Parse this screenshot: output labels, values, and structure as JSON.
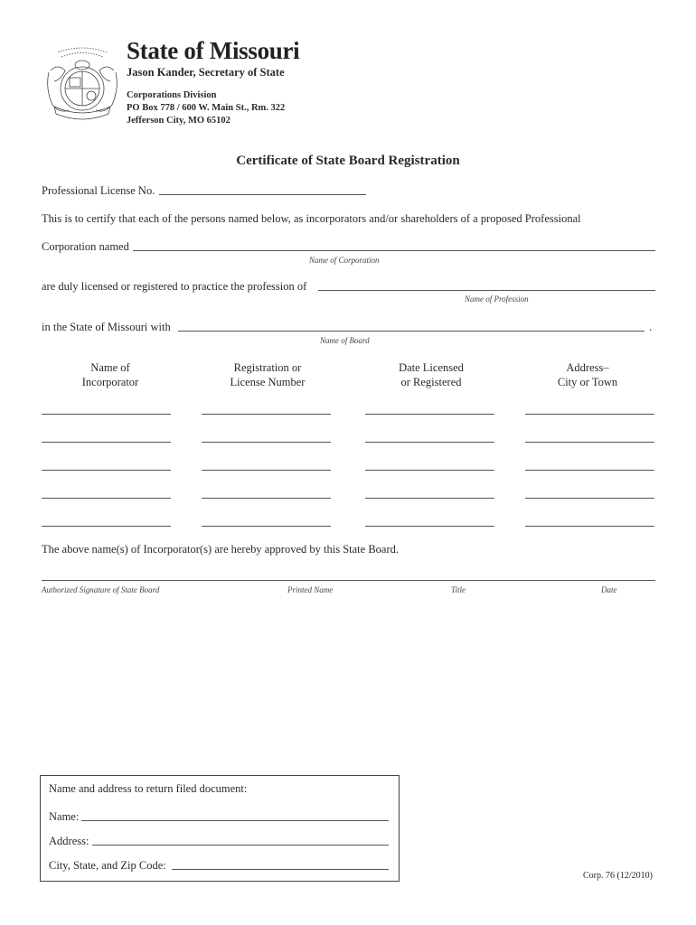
{
  "header": {
    "seal_icon": "missouri-state-seal",
    "state_title": "State of Missouri",
    "secretary": "Jason Kander, Secretary of State",
    "division": "Corporations Division",
    "address_line1": "PO Box 778 / 600 W. Main St., Rm. 322",
    "address_line2": "Jefferson City, MO 65102"
  },
  "document_title": "Certificate of State Board Registration",
  "fields": {
    "license_no_label": "Professional License No.",
    "license_no_value": "",
    "certify_text": "This is to certify that each of the persons named below, as incorporators and/or shareholders of a proposed Professional",
    "corporation_label": "Corporation named",
    "corporation_value": "",
    "corporation_caption": "Name of Corporation",
    "profession_label": "are duly licensed or registered to practice the profession of",
    "profession_value": "",
    "profession_caption": "Name of Profession",
    "board_label": "in the State of Missouri with",
    "board_value": "",
    "board_caption": "Name of Board",
    "board_period": "."
  },
  "incorporators_table": {
    "columns": [
      {
        "line1": "Name of",
        "line2": "Incorporator"
      },
      {
        "line1": "Registration or",
        "line2": "License Number"
      },
      {
        "line1": "Date Licensed",
        "line2": "or Registered"
      },
      {
        "line1": "Address–",
        "line2": "City or Town"
      }
    ],
    "rows": [
      [
        "",
        "",
        "",
        ""
      ],
      [
        "",
        "",
        "",
        ""
      ],
      [
        "",
        "",
        "",
        ""
      ],
      [
        "",
        "",
        "",
        ""
      ],
      [
        "",
        "",
        "",
        ""
      ]
    ]
  },
  "approval": {
    "statement": "The above name(s) of Incorporator(s) are hereby approved by this State Board.",
    "captions": {
      "signature": "Authorized Signature of State Board",
      "printed_name": "Printed Name",
      "title": "Title",
      "date": "Date"
    }
  },
  "return_box": {
    "heading": "Name and address to return filed document:",
    "name_label": "Name:",
    "name_value": "",
    "address_label": "Address:",
    "address_value": "",
    "city_label": "City, State, and Zip Code:",
    "city_value": ""
  },
  "form_id": "Corp. 76 (12/2010)"
}
